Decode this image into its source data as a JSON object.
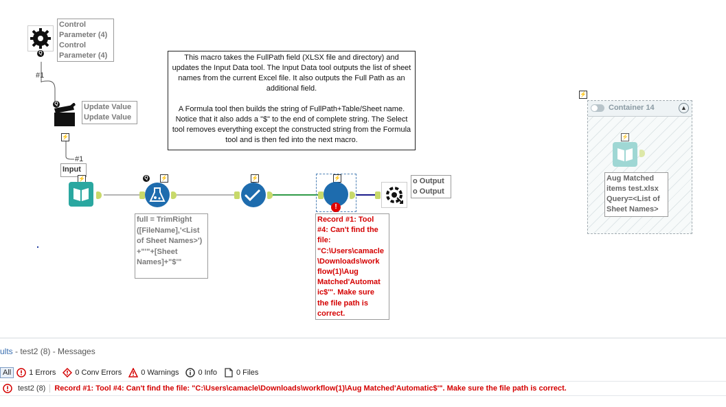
{
  "canvas": {
    "control_param_annotation": [
      "Control",
      "Parameter (4)",
      "Control",
      "Parameter (4)"
    ],
    "update_value_annotation": [
      "Update Value",
      "Update Value"
    ],
    "connection_label_1": "#1",
    "connection_label_2": "#1",
    "input_label": "Input",
    "output_annotation": [
      "o Output",
      "o Output"
    ],
    "note_text_1": "This macro takes the FullPath field (XLSX file and directory) and updates the Input Data tool.  The Input Data tool outputs the list of sheet names from the current Excel file.  It also outputs the Full Path as an additional field.",
    "note_text_2": "A Formula tool then builds the string of FullPath+Table/Sheet name.  Notice that it also adds a \"$\" to the end of complete string.  The Select tool removes everything except the constructed string from the Formula tool and is then fed into the next macro.",
    "formula_annotation": [
      "full = TrimRight",
      "([FileName],'<List",
      "of Sheet Names>')",
      "+\"'\"+[Sheet",
      "Names]+\"$'\""
    ],
    "error_annotation": [
      "Record #1: Tool",
      "#4: Can't find the",
      "file:",
      "\"C:\\Users\\camacle",
      "\\Downloads\\work",
      "flow(1)\\Aug",
      "Matched'Automat",
      "ic$'\". Make sure",
      "the file path is",
      "correct."
    ],
    "container_title": "Container 14",
    "container_annotation": [
      "Aug Matched",
      "items test.xlsx",
      "Query=<List of",
      "Sheet Names>"
    ],
    "bolt_glyph": "⚡",
    "q_glyph": "Q",
    "anchor_glyph_in": "i",
    "anchor_glyph_out": "o"
  },
  "results": {
    "title_prefix": "ults",
    "title_rest": " - test2 (8) - Messages",
    "filter_all": "All",
    "filter_errors": "1 Errors",
    "filter_conv_errors": "0 Conv Errors",
    "filter_warnings": "0 Warnings",
    "filter_info": "0 Info",
    "filter_files": "0 Files",
    "message_source": "test2 (8)",
    "message_text": "Record #1: Tool #4: Can't find the file: \"C:\\Users\\camacle\\Downloads\\workflow(1)\\Aug Matched'Automatic$'\". Make sure the file path is correct."
  },
  "colors": {
    "error_red": "#d40000",
    "tool_blue": "#1e6cae",
    "input_teal": "#2aa7a0",
    "anchor_green": "#c8d96a",
    "connection_green": "#2f9a47",
    "connection_navy": "#1a1a8a"
  }
}
